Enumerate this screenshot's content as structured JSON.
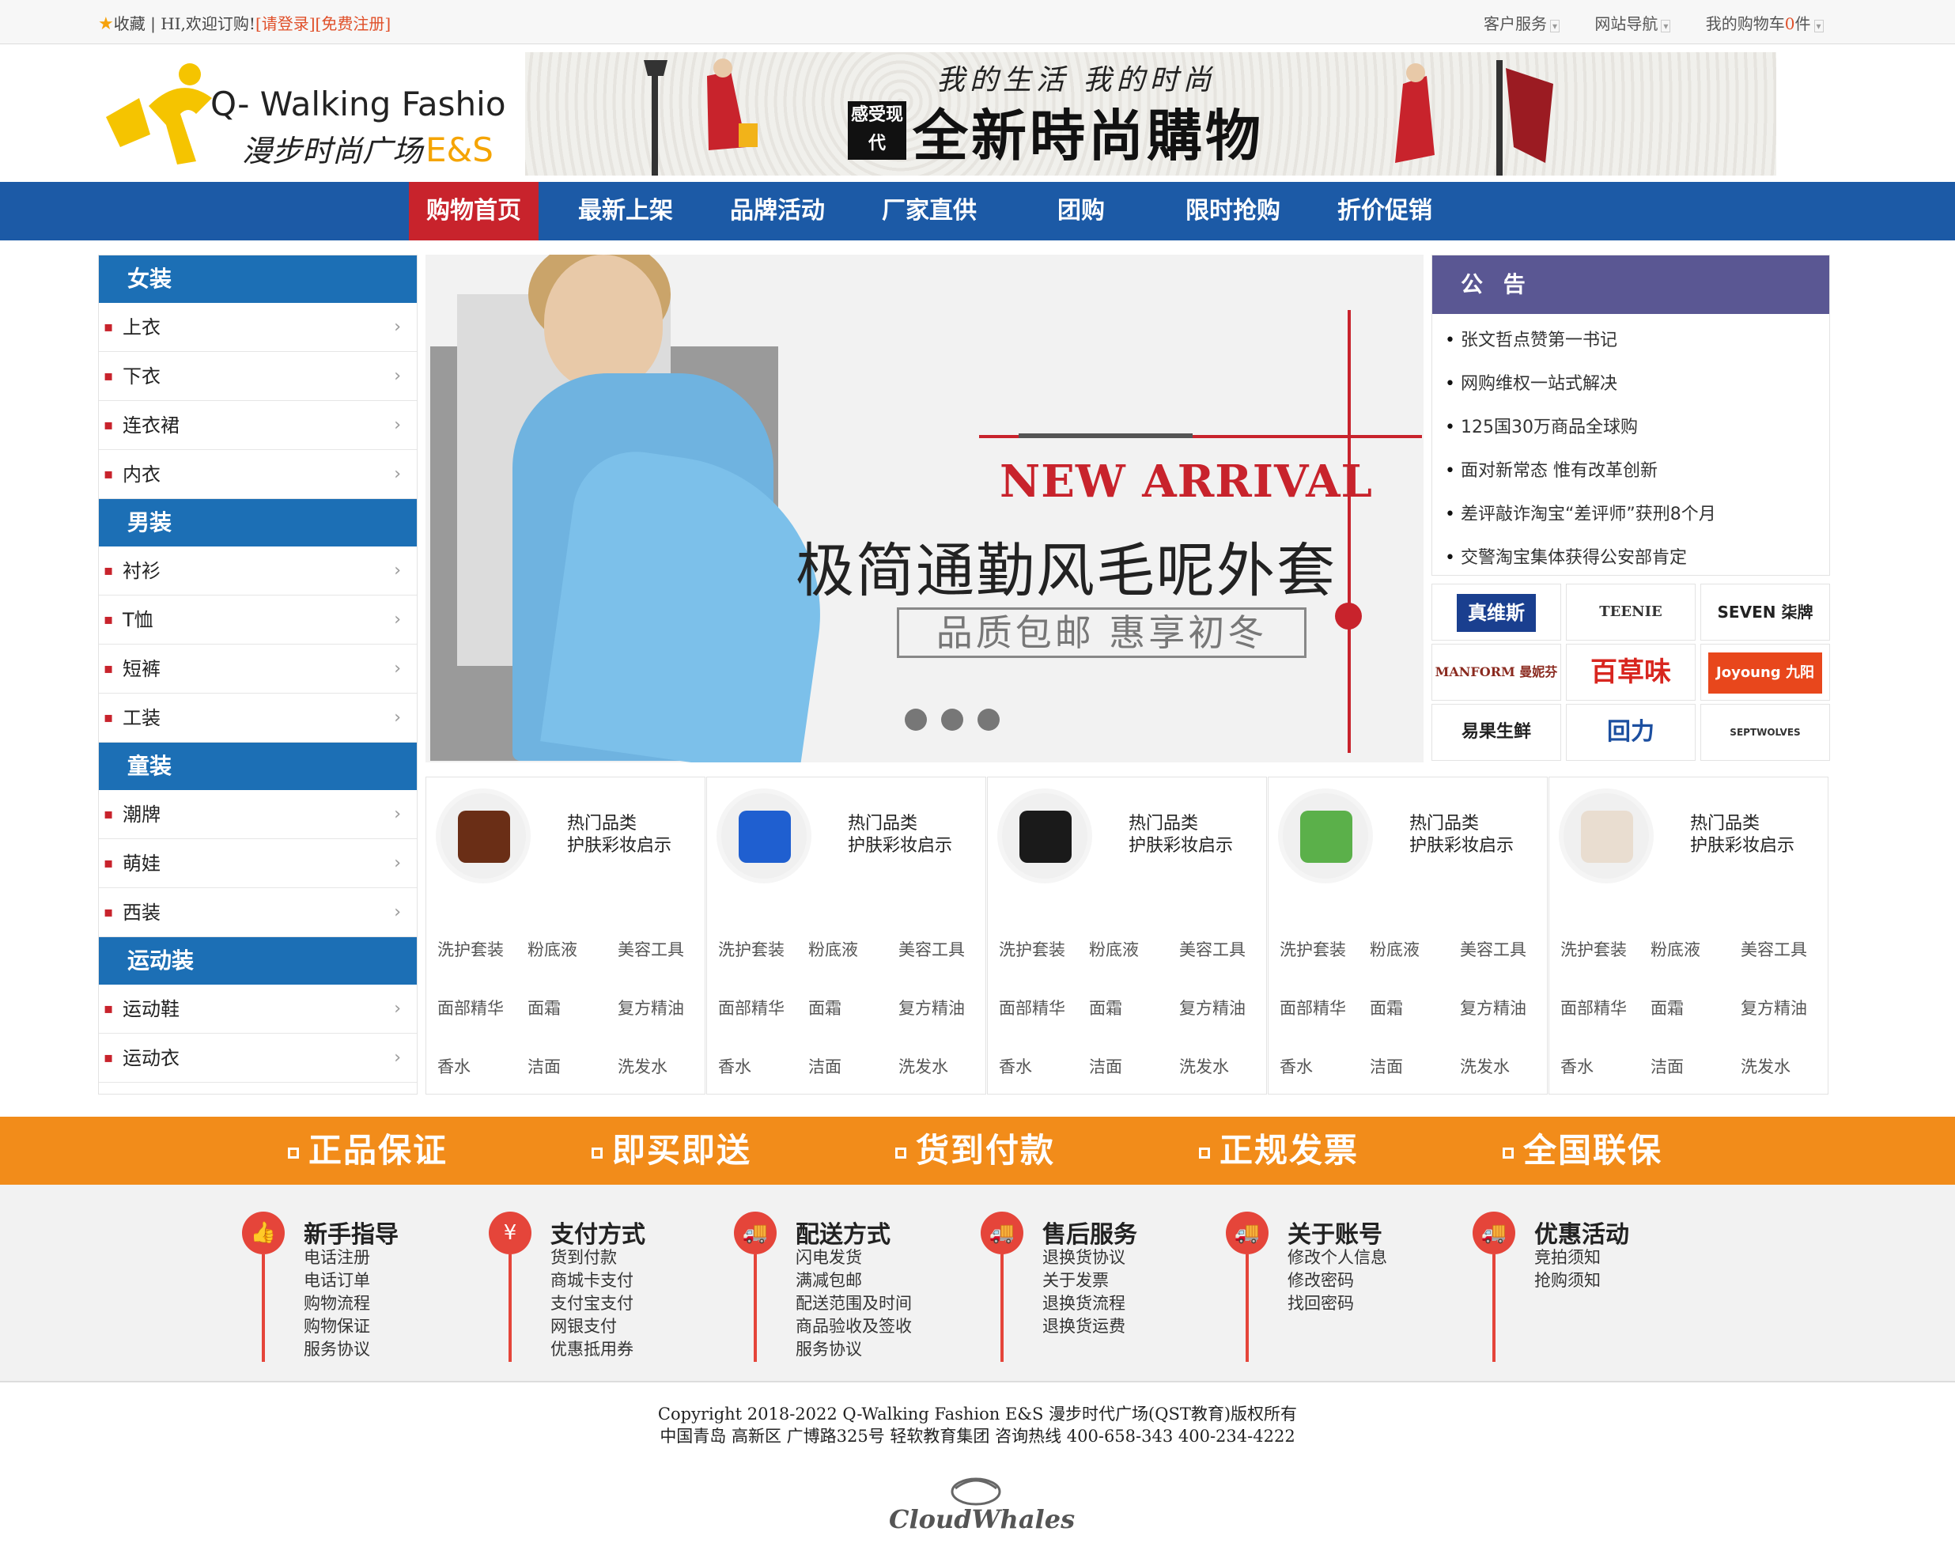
{
  "topbar": {
    "favorite": "收藏",
    "welcome": "HI,欢迎订购!",
    "login": "[请登录]",
    "register": "[免费注册]",
    "customer_service": "客户服务",
    "site_nav": "网站导航",
    "cart_prefix": "我的购物车",
    "cart_count": "0",
    "cart_suffix": "件"
  },
  "header": {
    "logo_en": "Q- Walking Fashion",
    "logo_cn": "漫步时尚广场",
    "logo_suffix": "E&S",
    "banner_slogan_top": "我的生活 我的时尚",
    "banner_badge": "感受现代",
    "banner_main": "全新時尚購物"
  },
  "nav": [
    "购物首页",
    "最新上架",
    "品牌活动",
    "厂家直供",
    "团购",
    "限时抢购",
    "折价促销"
  ],
  "sidebar": [
    {
      "title": "女装",
      "items": [
        "上衣",
        "下衣",
        "连衣裙",
        "内衣"
      ]
    },
    {
      "title": "男装",
      "items": [
        "衬衫",
        "T恤",
        "短裤",
        "工装"
      ]
    },
    {
      "title": "童装",
      "items": [
        "潮牌",
        "萌娃",
        "西装"
      ]
    },
    {
      "title": "运动装",
      "items": [
        "运动鞋",
        "运动衣"
      ]
    }
  ],
  "slider": {
    "headline": "NEW ARRIVAL",
    "subtitle": "极简通勤风毛呢外套",
    "tagline": "品质包邮 惠享初冬"
  },
  "notice": {
    "title": "公 告",
    "items": [
      "张文哲点赞第一书记",
      "网购维权一站式解决",
      "125国30万商品全球购",
      "面对新常态 惟有改革创新",
      "差评敲诈淘宝“差评师”获刑8个月",
      "交警淘宝集体获得公安部肯定"
    ]
  },
  "brands": [
    "真维斯",
    "TEENIE WEENIE",
    "SEVEN 柒牌",
    "MANFORM 曼妮芬",
    "百草味",
    "Joyoung 九阳",
    "易果生鲜",
    "回力",
    "SEPTWOLVES"
  ],
  "products": {
    "title1": "热门品类",
    "title2": "护肤彩妆启示",
    "keywords": [
      "洗护套装",
      "粉底液",
      "美容工具",
      "面部精华",
      "面霜",
      "复方精油",
      "香水",
      "洁面",
      "洗发水"
    ],
    "colors": [
      "#6a2e16",
      "#1f5fd0",
      "#1a1a1a",
      "#5bb04a",
      "#e9ddd0"
    ]
  },
  "guarantee": [
    "正品保证",
    "即买即送",
    "货到付款",
    "正规发票",
    "全国联保"
  ],
  "help": [
    {
      "title": "新手指导",
      "icon": "thumbs-up-icon",
      "glyph": "👍",
      "links": [
        "电话注册",
        "电话订单",
        "购物流程",
        "购物保证",
        "服务协议"
      ]
    },
    {
      "title": "支付方式",
      "icon": "yen-icon",
      "glyph": "¥",
      "links": [
        "货到付款",
        "商城卡支付",
        "支付宝支付",
        "网银支付",
        "优惠抵用券"
      ]
    },
    {
      "title": "配送方式",
      "icon": "truck-icon",
      "glyph": "🚚",
      "links": [
        "闪电发货",
        "满减包邮",
        "配送范围及时间",
        "商品验收及签收",
        "服务协议"
      ]
    },
    {
      "title": "售后服务",
      "icon": "truck-icon",
      "glyph": "🚚",
      "links": [
        "退换货协议",
        "关于发票",
        "退换货流程",
        "退换货运费"
      ]
    },
    {
      "title": "关于账号",
      "icon": "truck-icon",
      "glyph": "🚚",
      "links": [
        "修改个人信息",
        "修改密码",
        "找回密码"
      ]
    },
    {
      "title": "优惠活动",
      "icon": "truck-icon",
      "glyph": "🚚",
      "links": [
        "竞拍须知",
        "抢购须知"
      ]
    }
  ],
  "footer": {
    "copyright": "Copyright 2018-2022 Q-Walking Fashion E&S 漫步时代广场(QST教育)版权所有",
    "address": "中国青岛 高新区 广博路325号 轻软教育集团 咨询热线 400-658-343 400-234-4222",
    "logo_text": "CloudWhales"
  },
  "colors": {
    "nav": "#1c5aa6",
    "active": "#c8232c",
    "orange": "#f28c1a",
    "notice": "#5a5793",
    "category": "#1c6fb5"
  }
}
